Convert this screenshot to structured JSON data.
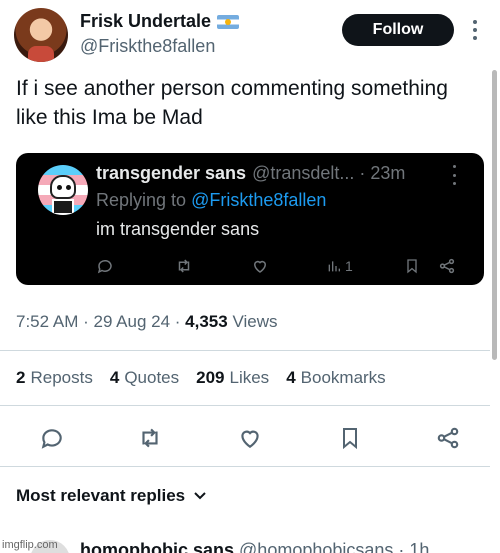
{
  "author": {
    "display_name": "Frisk Undertale",
    "handle": "@Friskthe8fallen",
    "follow_label": "Follow"
  },
  "post": {
    "text": "If i see another person commenting something like this Ima be Mad"
  },
  "quote": {
    "display_name": "transgender sans",
    "handle": "@transdelt...",
    "time": "· 23m",
    "replying_prefix": "Replying to",
    "replying_to": "@Friskthe8fallen",
    "text": "im transgender sans",
    "views": "1"
  },
  "meta": {
    "time": "7:52 AM",
    "date": "29 Aug 24",
    "views_count": "4,353",
    "views_label": "Views",
    "sep1": " · ",
    "sep2": " · "
  },
  "stats": [
    {
      "num": "2",
      "label": "Reposts"
    },
    {
      "num": "4",
      "label": "Quotes"
    },
    {
      "num": "209",
      "label": "Likes"
    },
    {
      "num": "4",
      "label": "Bookmarks"
    }
  ],
  "replies": {
    "sort_label": "Most relevant replies"
  },
  "next_reply": {
    "display_name": "homophobic sans",
    "handle": "@homophobicsans · 1h"
  },
  "watermark": "imgflip.com",
  "colors": {
    "text": "#0f1419",
    "secondary": "#536471",
    "link": "#1d9bf0",
    "quote_bg": "#000000"
  }
}
